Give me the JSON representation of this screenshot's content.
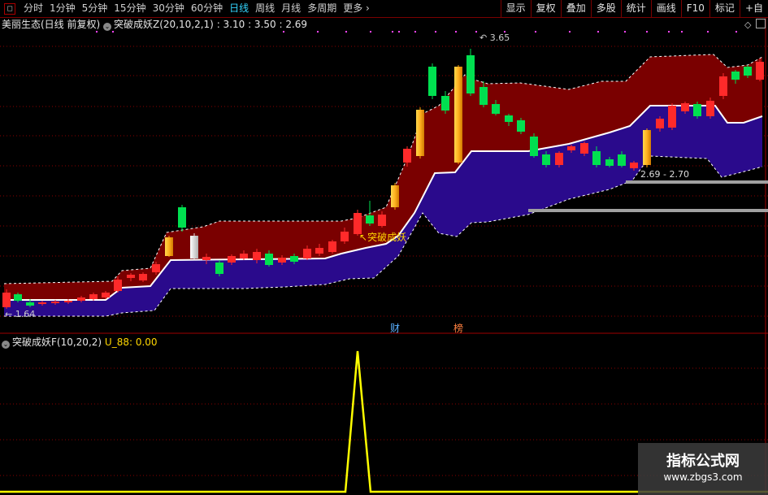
{
  "toolbar": {
    "periods": [
      "分时",
      "1分钟",
      "5分钟",
      "15分钟",
      "30分钟",
      "60分钟",
      "日线",
      "周线",
      "月线",
      "多周期",
      "更多"
    ],
    "active_period": "日线",
    "right_buttons": [
      "显示",
      "复权",
      "叠加",
      "多股",
      "统计",
      "画线",
      "F10",
      "标记",
      "+自"
    ]
  },
  "main_panel": {
    "stock_title": "美丽生态(日线 前复权)",
    "indicator_label": "突破成妖Z(20,10,2,1)",
    "indicator_values": ": 3.10 : 3.50 : 2.69",
    "high_label": "3.65",
    "low_label": "1.64",
    "range_label": "2.69 - 2.70",
    "signal_label": "突破成妖",
    "marker_cai": "财",
    "marker_bang": "榜"
  },
  "sub_panel": {
    "indicator_label": "突破成妖F(10,20,2)",
    "value_label": "U_88: 0.00"
  },
  "watermark": {
    "line1": "指标公式网",
    "line2": "www.zbgs3.com"
  },
  "colors": {
    "up_candle": "#ff2a2a",
    "down_candle": "#00e050",
    "upper_band": "#7a0000",
    "lower_band": "#2a0a8c",
    "signal_bar": "#ffa500",
    "sub_line": "#ffff00",
    "grid": "#8a0000"
  }
}
